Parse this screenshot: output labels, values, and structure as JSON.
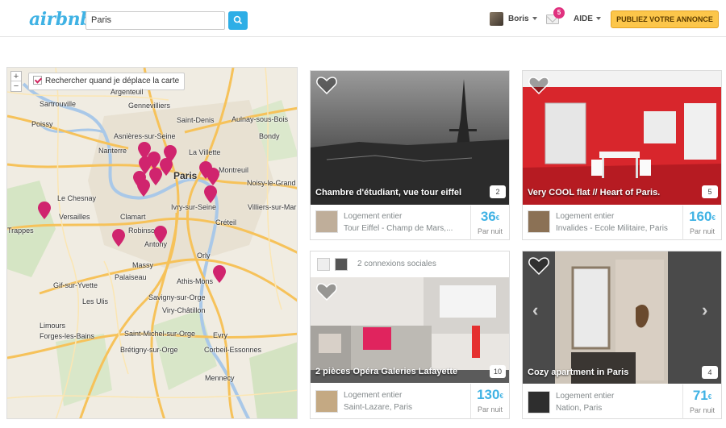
{
  "header": {
    "logo": "airbnb",
    "search_value": "Paris",
    "user_name": "Boris",
    "notification_count": "5",
    "help_label": "AIDE",
    "publish_label": "PUBLIEZ VOTRE ANNONCE"
  },
  "map": {
    "zoom_in": "+",
    "zoom_out": "−",
    "move_search_label": "Rechercher quand je déplace la carte",
    "labels": [
      "Argenteuil",
      "Gennevilliers",
      "Saint-Denis",
      "Aulnay-sous-Bois",
      "Sartrouville",
      "Asnières-sur-Seine",
      "Bondy",
      "Nanterre",
      "La Villette",
      "Montreuil",
      "Paris",
      "Le Chesnay",
      "Versailles",
      "Clamart",
      "Ivry-sur-Seine",
      "Noisy-le-Grand",
      "Créteil",
      "Villiers-sur-Marne",
      "Robinson",
      "Antony",
      "Massy",
      "Orly",
      "Palaiseau",
      "Athis-Mons",
      "Gif-sur-Yvette",
      "Savigny-sur-Orge",
      "Les Ulis",
      "Viry-Châtillon",
      "Limours",
      "Saint-Michel-sur-Orge",
      "Evry",
      "Brétigny-sur-Orge",
      "Corbeil-Essonnes",
      "Poissy",
      "Trappes",
      "Forges-les-Bains",
      "Mennecy"
    ],
    "pin_color": "#d0246e"
  },
  "listings": [
    {
      "title": "Chambre d'étudiant, vue tour eiffel",
      "reviews": "2",
      "type": "Logement entier",
      "location": "Tour Eiffel - Champ de Mars,...",
      "price": "36",
      "currency": "€",
      "per_night": "Par nuit"
    },
    {
      "title": "Very COOL flat // Heart of Paris.",
      "reviews": "5",
      "type": "Logement entier",
      "location": "Invalides - Ecole Militaire, Paris",
      "price": "160",
      "currency": "€",
      "per_night": "Par nuit"
    },
    {
      "social": "2 connexions sociales",
      "title": "2 pièces Opéra Galeries Lafayette",
      "reviews": "10",
      "type": "Logement entier",
      "location": "Saint-Lazare, Paris",
      "price": "130",
      "currency": "€",
      "per_night": "Par nuit"
    },
    {
      "title": "Cozy apartment in Paris",
      "reviews": "4",
      "type": "Logement entier",
      "location": "Nation, Paris",
      "price": "71",
      "currency": "€",
      "per_night": "Par nuit"
    }
  ]
}
